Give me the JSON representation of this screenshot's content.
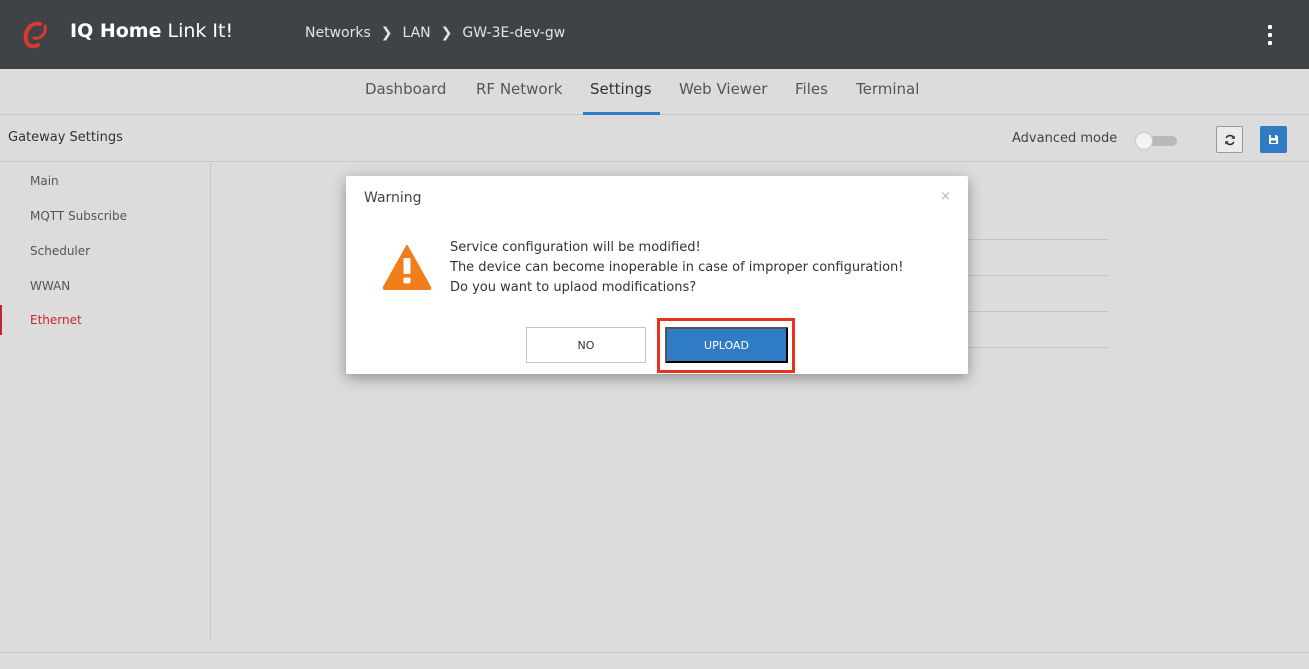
{
  "app": {
    "brand_bold": "IQ Home",
    "brand_rest": "Link It!",
    "breadcrumb": [
      "Networks",
      "LAN",
      "GW-3E-dev-gw"
    ]
  },
  "tabs": [
    {
      "label": "Dashboard"
    },
    {
      "label": "RF Network"
    },
    {
      "label": "Settings",
      "active": true
    },
    {
      "label": "Web Viewer"
    },
    {
      "label": "Files"
    },
    {
      "label": "Terminal"
    }
  ],
  "subheader": {
    "title": "Gateway Settings",
    "advanced_label": "Advanced mode",
    "advanced_enabled": false
  },
  "sidebar": {
    "items": [
      {
        "label": "Main"
      },
      {
        "label": "MQTT Subscribe"
      },
      {
        "label": "Scheduler"
      },
      {
        "label": "WWAN"
      },
      {
        "label": "Ethernet",
        "active": true
      }
    ]
  },
  "modal": {
    "title": "Warning",
    "close": "×",
    "lines": [
      "Service configuration will be modified!",
      "The device can become inoperable in case of improper configuration!",
      "Do you want to uplaod modifications?"
    ],
    "no_label": "NO",
    "upload_label": "UPLOAD"
  },
  "icons": {
    "logo": "link-logo-icon",
    "refresh": "refresh-icon",
    "save": "save-icon",
    "menu": "kebab-menu-icon",
    "warning": "warning-icon"
  },
  "colors": {
    "topbar": "#3f4247",
    "accent": "#2f7cc4",
    "active_nav": "#c8242f",
    "warning": "#f27e1b",
    "highlight": "#e8321f"
  }
}
